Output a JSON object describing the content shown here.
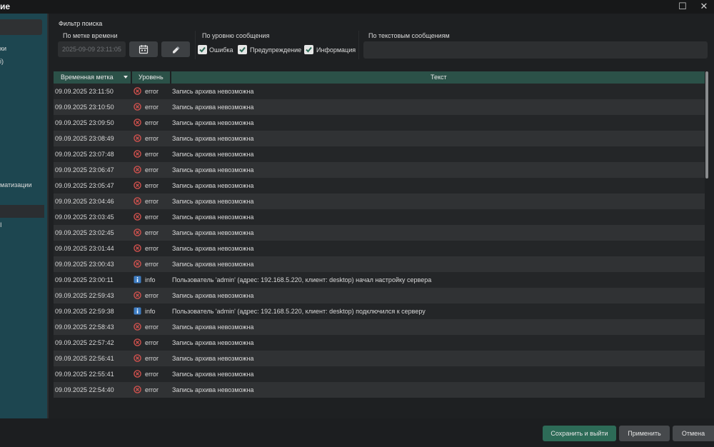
{
  "window": {
    "title": "ие"
  },
  "sidebar": {
    "items": [
      {
        "label": "ки"
      },
      {
        "label": "і)"
      },
      {
        "label": "матизации"
      },
      {
        "label": "І"
      }
    ]
  },
  "filter": {
    "title": "Фильтр поиска",
    "time": {
      "label": "По метке времени",
      "value": "2025-09-09 23:11:05",
      "calendar_icon": "calendar-icon",
      "clear_icon": "eraser-icon"
    },
    "levels": {
      "label": "По уровню сообщения",
      "error": "Ошибка",
      "warning": "Предупреждение",
      "info": "Информация"
    },
    "text": {
      "label": "По текстовым сообщениям",
      "value": ""
    }
  },
  "table": {
    "columns": {
      "time": "Временная метка",
      "level": "Уровень",
      "text": "Текст"
    },
    "rows": [
      {
        "time": "09.09.2025 23:11:50",
        "level": "error",
        "text": "Запись архива невозможна"
      },
      {
        "time": "09.09.2025 23:10:50",
        "level": "error",
        "text": "Запись архива невозможна"
      },
      {
        "time": "09.09.2025 23:09:50",
        "level": "error",
        "text": "Запись архива невозможна"
      },
      {
        "time": "09.09.2025 23:08:49",
        "level": "error",
        "text": "Запись архива невозможна"
      },
      {
        "time": "09.09.2025 23:07:48",
        "level": "error",
        "text": "Запись архива невозможна"
      },
      {
        "time": "09.09.2025 23:06:47",
        "level": "error",
        "text": "Запись архива невозможна"
      },
      {
        "time": "09.09.2025 23:05:47",
        "level": "error",
        "text": "Запись архива невозможна"
      },
      {
        "time": "09.09.2025 23:04:46",
        "level": "error",
        "text": "Запись архива невозможна"
      },
      {
        "time": "09.09.2025 23:03:45",
        "level": "error",
        "text": "Запись архива невозможна"
      },
      {
        "time": "09.09.2025 23:02:45",
        "level": "error",
        "text": "Запись архива невозможна"
      },
      {
        "time": "09.09.2025 23:01:44",
        "level": "error",
        "text": "Запись архива невозможна"
      },
      {
        "time": "09.09.2025 23:00:43",
        "level": "error",
        "text": "Запись архива невозможна"
      },
      {
        "time": "09.09.2025 23:00:11",
        "level": "info",
        "text": "Пользователь 'admin' (адрес: 192.168.5.220, клиент: desktop) начал настройку сервера"
      },
      {
        "time": "09.09.2025 22:59:43",
        "level": "error",
        "text": "Запись архива невозможна"
      },
      {
        "time": "09.09.2025 22:59:38",
        "level": "info",
        "text": "Пользователь 'admin' (адрес: 192.168.5.220, клиент: desktop) подключился к серверу"
      },
      {
        "time": "09.09.2025 22:58:43",
        "level": "error",
        "text": "Запись архива невозможна"
      },
      {
        "time": "09.09.2025 22:57:42",
        "level": "error",
        "text": "Запись архива невозможна"
      },
      {
        "time": "09.09.2025 22:56:41",
        "level": "error",
        "text": "Запись архива невозможна"
      },
      {
        "time": "09.09.2025 22:55:41",
        "level": "error",
        "text": "Запись архива невозможна"
      },
      {
        "time": "09.09.2025 22:54:40",
        "level": "error",
        "text": "Запись архива невозможна"
      }
    ]
  },
  "footer": {
    "save_exit": "Сохранить и выйти",
    "apply": "Применить",
    "cancel": "Отмена"
  },
  "colors": {
    "accent": "#2d6b57",
    "header": "#2b5148",
    "sidebar": "#1d4650",
    "error": "#d9534f",
    "info": "#3f7ec4"
  }
}
